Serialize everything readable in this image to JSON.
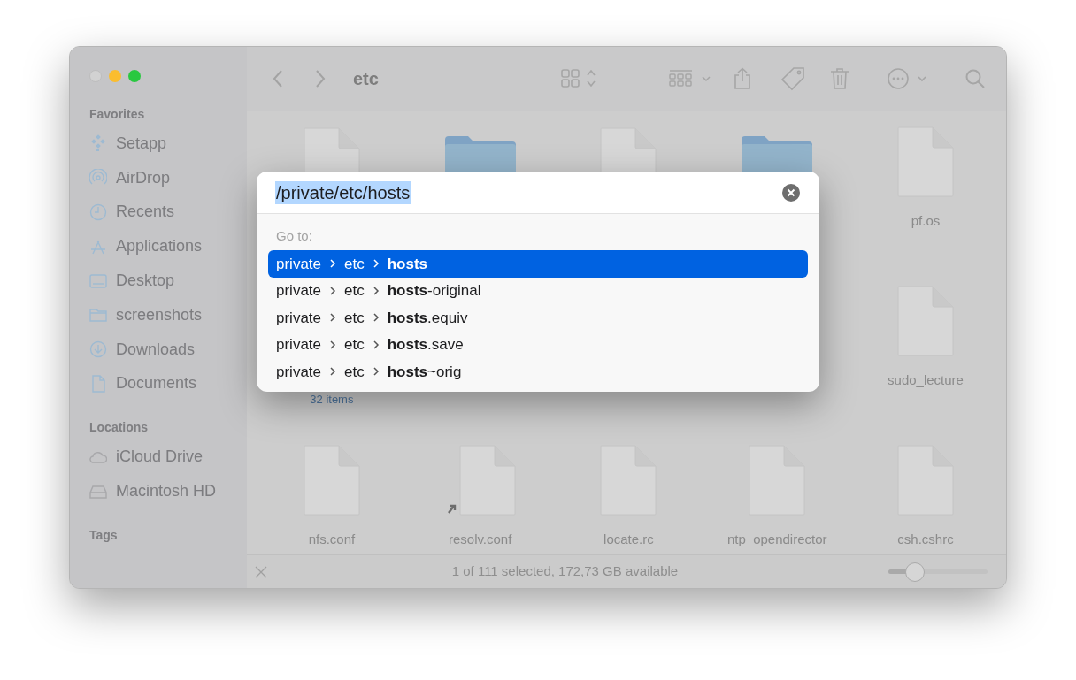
{
  "window": {
    "title": "etc"
  },
  "sidebar": {
    "sections": [
      {
        "heading": "Favorites",
        "items": [
          {
            "label": "Setapp"
          },
          {
            "label": "AirDrop"
          },
          {
            "label": "Recents"
          },
          {
            "label": "Applications"
          },
          {
            "label": "Desktop"
          },
          {
            "label": "screenshots"
          },
          {
            "label": "Downloads"
          },
          {
            "label": "Documents"
          }
        ]
      },
      {
        "heading": "Locations",
        "items": [
          {
            "label": "iCloud Drive"
          },
          {
            "label": "Macintosh HD"
          }
        ]
      },
      {
        "heading": "Tags"
      }
    ]
  },
  "files": {
    "rows": [
      [
        {
          "kind": "file"
        },
        {
          "kind": "folder"
        },
        {
          "kind": "file"
        },
        {
          "kind": "folder"
        },
        {
          "kind": "file",
          "name": "pf.os"
        }
      ],
      [
        {
          "kind": "caption",
          "subtitle": "32 items"
        },
        "",
        "",
        "",
        {
          "kind": "file",
          "name": "sudo_lecture"
        }
      ],
      [
        {
          "kind": "file",
          "name": "nfs.conf"
        },
        {
          "kind": "alias",
          "name": "resolv.conf"
        },
        {
          "kind": "file",
          "name": "locate.rc"
        },
        {
          "kind": "file",
          "name": "ntp_opendirector"
        },
        {
          "kind": "file",
          "name": "csh.cshrc"
        }
      ]
    ]
  },
  "status_bar": {
    "text": "1 of 111 selected, 172,73 GB available",
    "zoom": {
      "level": 0.27
    }
  },
  "go_to_dialog": {
    "value": "/private/etc/hosts",
    "section_label": "Go to:",
    "suggestions": [
      {
        "path": [
          "private",
          "etc"
        ],
        "name": "**hosts**",
        "selected": true
      },
      {
        "path": [
          "private",
          "etc"
        ],
        "name": "**hosts**-original",
        "selected": false
      },
      {
        "path": [
          "private",
          "etc"
        ],
        "name": "**hosts**.equiv",
        "selected": false
      },
      {
        "path": [
          "private",
          "etc"
        ],
        "name": "**hosts**.save",
        "selected": false
      },
      {
        "path": [
          "private",
          "etc"
        ],
        "name": "**hosts**~orig",
        "selected": false
      }
    ]
  }
}
